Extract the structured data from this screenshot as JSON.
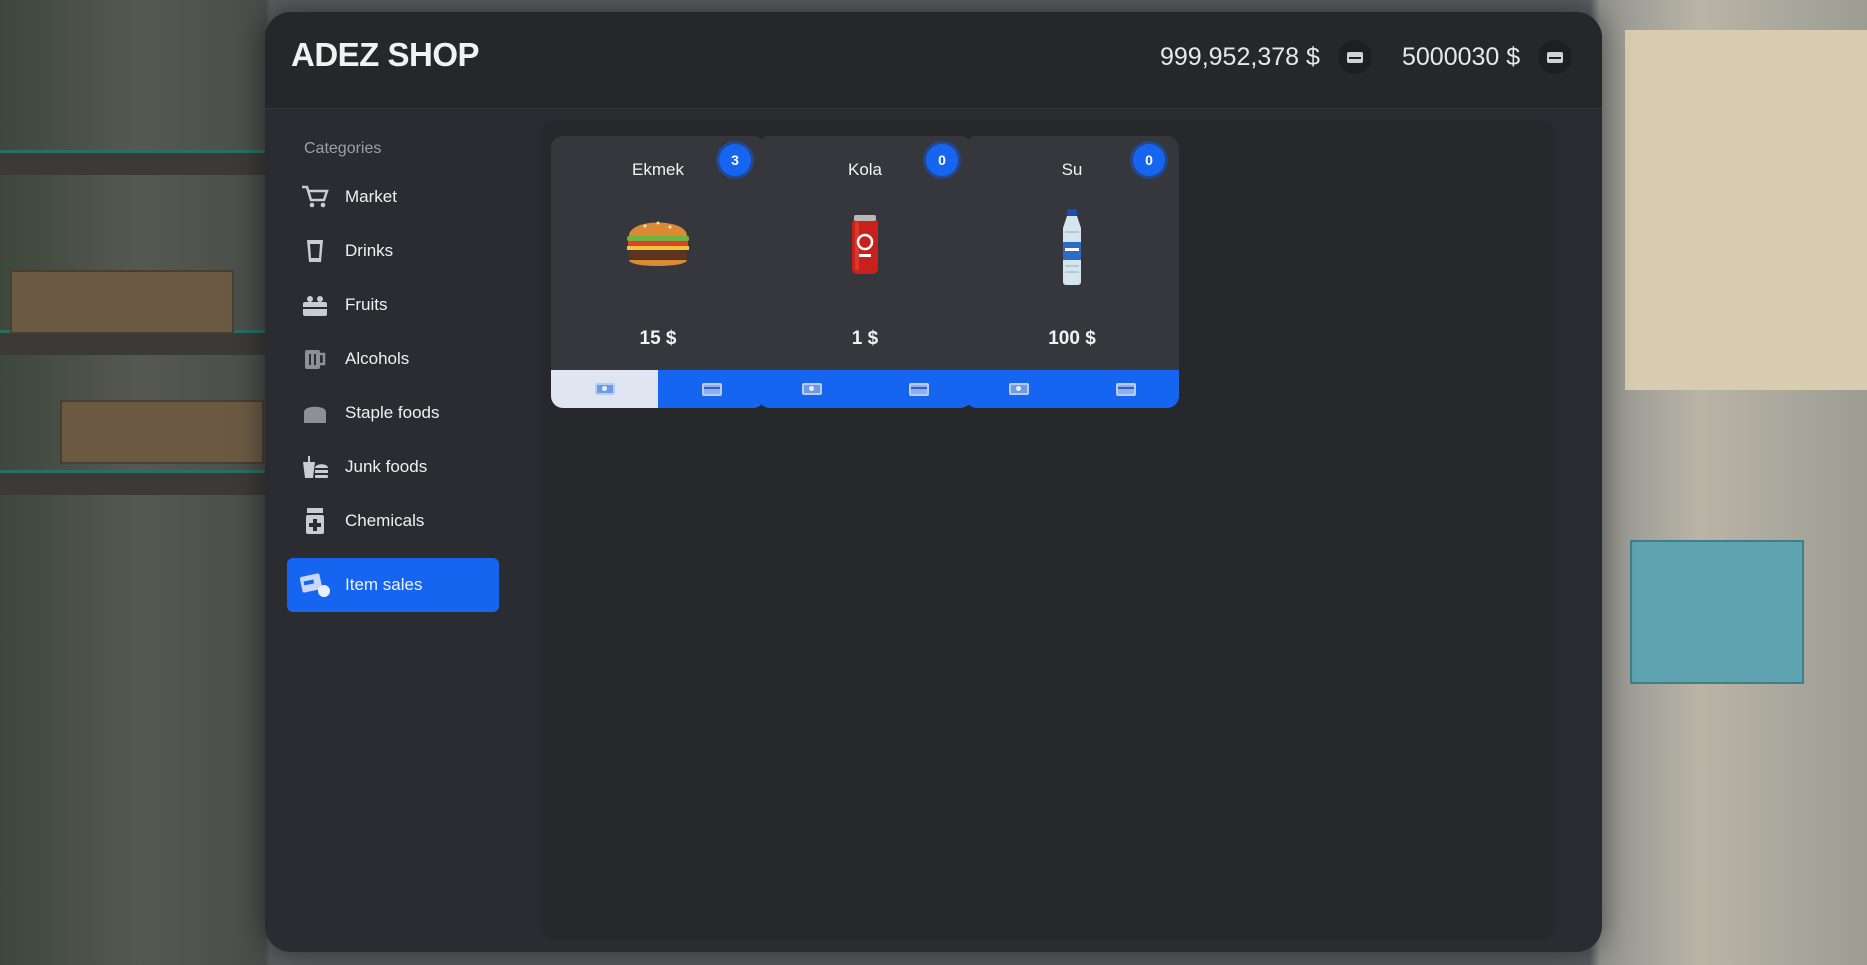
{
  "shop": {
    "title": "ADEZ SHOP"
  },
  "balances": {
    "cash": {
      "amount": "999,952,378 $",
      "icon": "wallet-icon"
    },
    "bank": {
      "amount": "5000030 $",
      "icon": "card-icon"
    }
  },
  "sidebar": {
    "heading": "Categories",
    "items": [
      {
        "label": "Market",
        "icon": "cart-icon"
      },
      {
        "label": "Drinks",
        "icon": "cup-icon"
      },
      {
        "label": "Fruits",
        "icon": "basket-icon"
      },
      {
        "label": "Alcohols",
        "icon": "mug-icon"
      },
      {
        "label": "Staple foods",
        "icon": "bread-icon"
      },
      {
        "label": "Junk foods",
        "icon": "fastfood-icon"
      },
      {
        "label": "Chemicals",
        "icon": "medicine-icon"
      },
      {
        "label": "Item sales",
        "icon": "sales-icon",
        "active": true
      }
    ]
  },
  "products": [
    {
      "name": "Ekmek",
      "quantity": "3",
      "price": "15 $",
      "image": "burger-image"
    },
    {
      "name": "Kola",
      "quantity": "0",
      "price": "1 $",
      "image": "cola-can-image"
    },
    {
      "name": "Su",
      "quantity": "0",
      "price": "100 $",
      "image": "water-bottle-image"
    }
  ],
  "colors": {
    "accent": "#1665f0",
    "panel": "#2a2c31",
    "card": "#35373c"
  }
}
